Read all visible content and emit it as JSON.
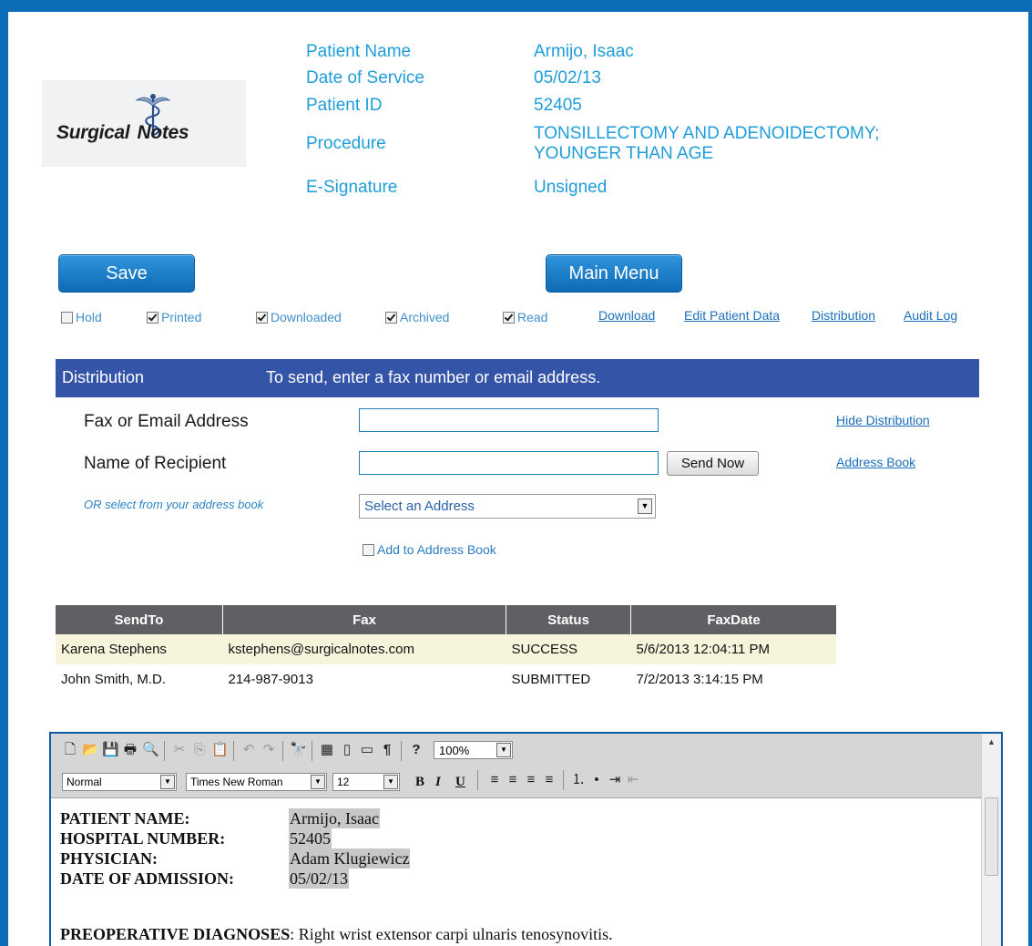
{
  "logo": {
    "text_left": "Surgical",
    "text_right": "Notes"
  },
  "patient": {
    "name_label": "Patient Name",
    "name_value": "Armijo, Isaac",
    "dos_label": "Date of Service",
    "dos_value": "05/02/13",
    "id_label": "Patient ID",
    "id_value": "52405",
    "procedure_label": "Procedure",
    "procedure_value": "TONSILLECTOMY AND ADENOIDECTOMY; YOUNGER THAN AGE",
    "esig_label": "E-Signature",
    "esig_value": "Unsigned"
  },
  "buttons": {
    "save": "Save",
    "main_menu": "Main Menu"
  },
  "flags": [
    {
      "label": "Hold",
      "checked": false
    },
    {
      "label": "Printed",
      "checked": true
    },
    {
      "label": "Downloaded",
      "checked": true
    },
    {
      "label": "Archived",
      "checked": true
    },
    {
      "label": "Read",
      "checked": true
    }
  ],
  "links": {
    "download": "Download",
    "edit": "Edit Patient Data",
    "distribution": "Distribution",
    "audit": "Audit Log"
  },
  "distribution": {
    "title": "Distribution",
    "instruction": "To send, enter a fax number or email address.",
    "fax_label": "Fax or Email Address",
    "fax_value": "",
    "recipient_label": "Name of Recipient",
    "recipient_value": "",
    "send_now": "Send Now",
    "hide": "Hide Distribution",
    "address_book": "Address Book",
    "or_select": "OR select from your address book",
    "select_value": "Select an Address",
    "add_to_book": "Add to Address Book"
  },
  "fax_table": {
    "headers": [
      "SendTo",
      "Fax",
      "Status",
      "FaxDate"
    ],
    "rows": [
      [
        "Karena Stephens",
        "kstephens@surgicalnotes.com",
        "SUCCESS",
        "5/6/2013 12:04:11 PM"
      ],
      [
        "John Smith, M.D.",
        "214-987-9013",
        "SUBMITTED",
        "7/2/2013 3:14:15 PM"
      ]
    ]
  },
  "editor": {
    "zoom": "100%",
    "style": "Normal",
    "font": "Times New Roman",
    "size": "12",
    "bold": "B",
    "italic": "I",
    "underline": "U",
    "fields": [
      {
        "key": "PATIENT NAME:",
        "value": "Armijo, Isaac"
      },
      {
        "key": "HOSPITAL NUMBER:",
        "value": "52405"
      },
      {
        "key": "PHYSICIAN:",
        "value": "Adam Klugiewicz"
      },
      {
        "key": "DATE OF ADMISSION:",
        "value": "05/02/13"
      }
    ],
    "preop_heading": "PREOPERATIVE DIAGNOSES",
    "preop_text": ":  Right wrist extensor carpi ulnaris tenosynovitis."
  }
}
